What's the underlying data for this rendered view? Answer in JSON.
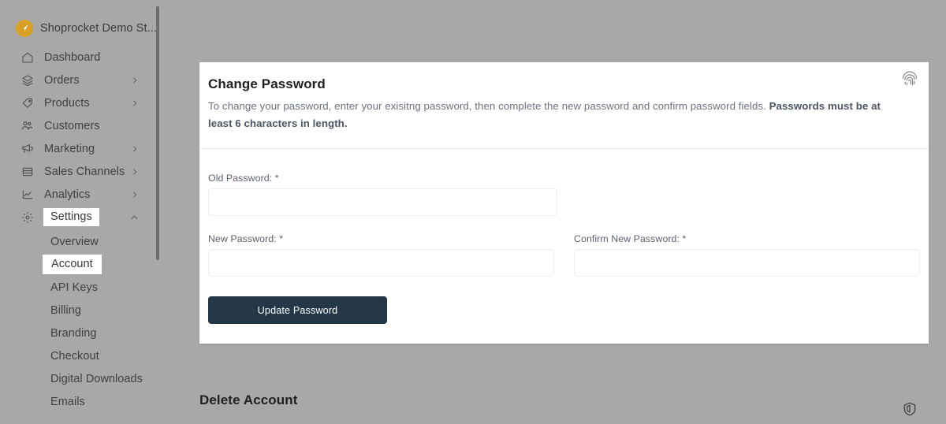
{
  "sidebar": {
    "brand": {
      "name": "Shoprocket Demo St...",
      "logo_icon": "rocket-logo-icon",
      "logo_color": "#d9a026"
    },
    "items": [
      {
        "label": "Dashboard",
        "icon": "home-icon",
        "chevron": "",
        "highlight": false
      },
      {
        "label": "Orders",
        "icon": "orders-icon",
        "chevron": "›",
        "highlight": false
      },
      {
        "label": "Products",
        "icon": "tag-icon",
        "chevron": "›",
        "highlight": false
      },
      {
        "label": "Customers",
        "icon": "users-icon",
        "chevron": "",
        "highlight": false
      },
      {
        "label": "Marketing",
        "icon": "megaphone-icon",
        "chevron": "›",
        "highlight": false
      },
      {
        "label": "Sales Channels",
        "icon": "store-icon",
        "chevron": "›",
        "highlight": false
      },
      {
        "label": "Analytics",
        "icon": "chart-icon",
        "chevron": "›",
        "highlight": false
      },
      {
        "label": "Settings",
        "icon": "gear-icon",
        "chevron": "^",
        "highlight": true
      }
    ],
    "subitems": [
      {
        "label": "Overview",
        "highlight": false
      },
      {
        "label": "Account",
        "highlight": true
      },
      {
        "label": "API Keys",
        "highlight": false
      },
      {
        "label": "Billing",
        "highlight": false
      },
      {
        "label": "Branding",
        "highlight": false
      },
      {
        "label": "Checkout",
        "highlight": false
      },
      {
        "label": "Digital Downloads",
        "highlight": false
      },
      {
        "label": "Emails",
        "highlight": false
      }
    ],
    "scrollbar": {
      "present": true
    }
  },
  "card": {
    "title": "Change Password",
    "desc_plain": "To change your password, enter your exisitng password, then complete the new password and confirm password fields. ",
    "desc_bold": "Passwords must be at least 6 characters in length.",
    "icon": "fingerprint-icon",
    "fields": {
      "old_password": {
        "label": "Old Password: *",
        "value": "",
        "placeholder": ""
      },
      "new_password": {
        "label": "New Password: *",
        "value": "",
        "placeholder": ""
      },
      "confirm_password": {
        "label": "Confirm New Password: *",
        "value": "",
        "placeholder": ""
      }
    },
    "submit_label": "Update Password",
    "submit_color": "#243746"
  },
  "delete_section": {
    "title": "Delete Account",
    "icon": "shield-icon"
  },
  "colors": {
    "page_background": "#a8a8a8",
    "card_background": "#ffffff",
    "accent": "#d9a026",
    "button": "#243746"
  }
}
